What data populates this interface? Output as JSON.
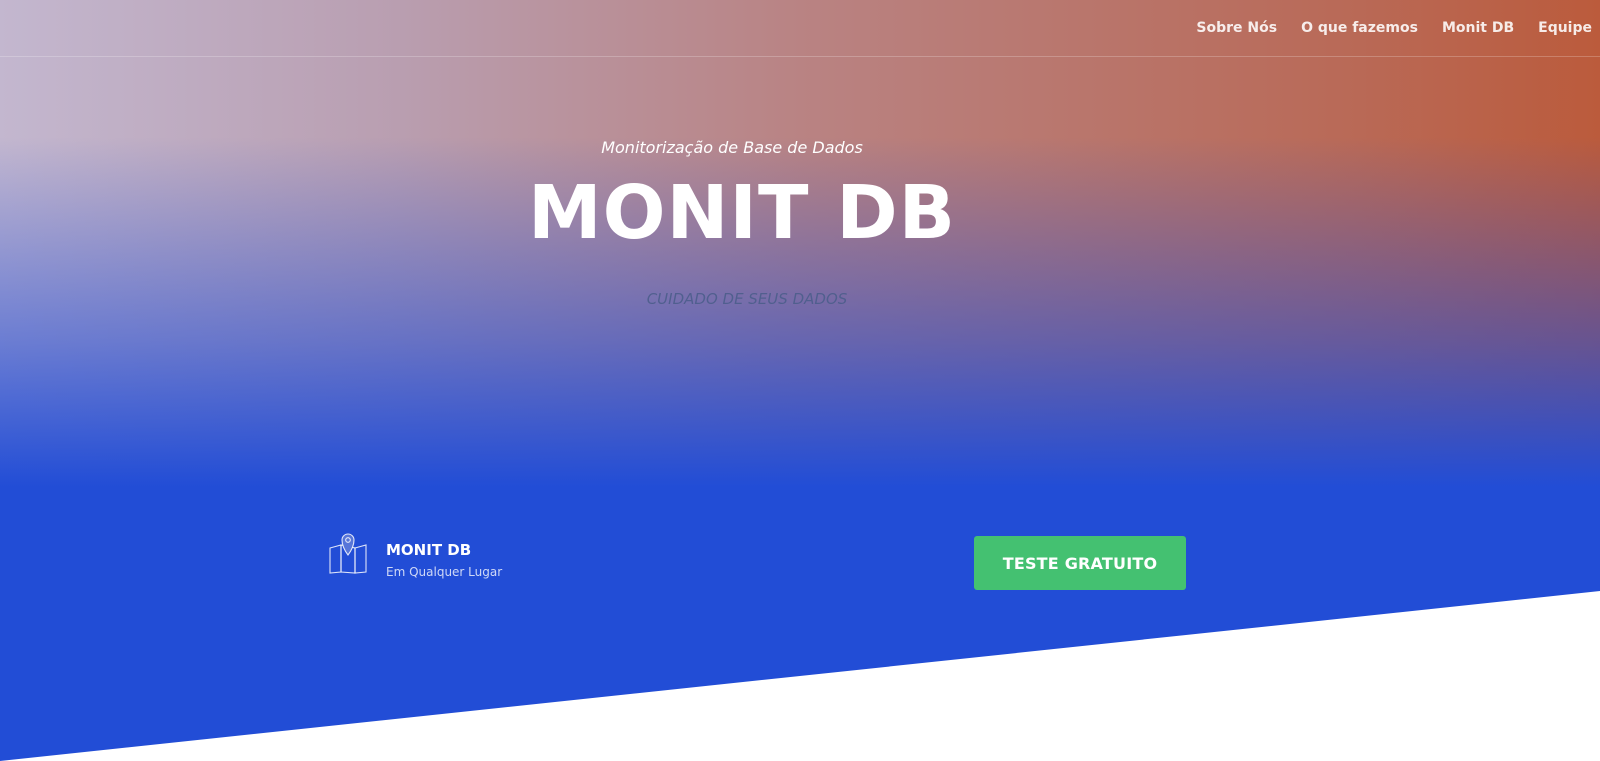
{
  "nav": {
    "items": [
      {
        "label": "Sobre Nós"
      },
      {
        "label": "O que fazemos"
      },
      {
        "label": "Monit DB"
      },
      {
        "label": "Equipe"
      }
    ]
  },
  "hero": {
    "subtitle": "Monitorização de Base de Dados",
    "title": "MONIT DB",
    "tagline": "CUIDADO DE SEUS DADOS"
  },
  "feature": {
    "icon": "map-pin-icon",
    "title": "MONIT DB",
    "subtitle": "Em Qualquer Lugar"
  },
  "cta": {
    "label": "TESTE GRATUITO"
  },
  "colors": {
    "hero_blue": "#224dd6",
    "cta_green": "#44c171",
    "top_left": "#c3b7cf",
    "top_right": "#bb5b3c",
    "tagline": "#4a5d8a"
  }
}
